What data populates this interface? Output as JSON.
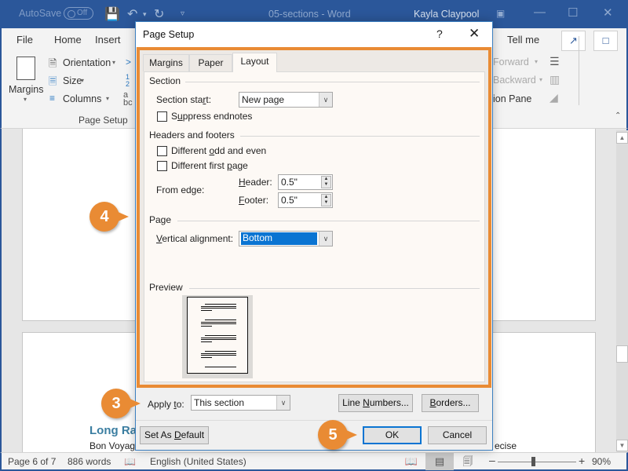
{
  "titlebar": {
    "autosave_label": "AutoSave",
    "autosave_state": "Off",
    "document_title": "05-sections - Word",
    "user_name": "Kayla Claypool"
  },
  "ribbon": {
    "tabs": [
      "File",
      "Home",
      "Insert"
    ],
    "tell_me": "Tell me",
    "page_setup": {
      "margins_label": "Margins",
      "orientation_label": "Orientation",
      "size_label": "Size",
      "columns_label": "Columns",
      "group_label": "Page Setup"
    },
    "arrange": {
      "bring_forward": "Forward",
      "send_backward": "Backward",
      "selection_pane": "ion Pane"
    }
  },
  "document": {
    "heading_partial": "Long Ran",
    "text_partial": "Bon Voyage",
    "text_right_partial": "ecise"
  },
  "dialog": {
    "title": "Page Setup",
    "help": "?",
    "tabs": [
      {
        "label": "Margins",
        "active": false
      },
      {
        "label": "Paper",
        "active": false
      },
      {
        "label": "Layout",
        "active": true
      }
    ],
    "section": {
      "heading": "Section",
      "section_start_label": "Section sta",
      "section_start_u": "r",
      "section_start_rest": "t:",
      "section_start_value": "New page",
      "suppress_endnotes_pre": "S",
      "suppress_endnotes_u": "u",
      "suppress_endnotes_rest": "ppress endnotes",
      "suppress_endnotes_checked": false
    },
    "headers_footers": {
      "heading": "Headers and footers",
      "odd_even_pre": "Different ",
      "odd_even_u": "o",
      "odd_even_rest": "dd and even",
      "odd_even_checked": false,
      "first_page_pre": "Different first ",
      "first_page_u": "p",
      "first_page_rest": "age",
      "first_page_checked": false,
      "from_edge_label": "From edge:",
      "header_u": "H",
      "header_rest": "eader:",
      "header_value": "0.5\"",
      "footer_u": "F",
      "footer_rest": "ooter:",
      "footer_value": "0.5\""
    },
    "page": {
      "heading": "Page",
      "vertical_alignment_u": "V",
      "vertical_alignment_rest": "ertical alignment:",
      "vertical_alignment_value": "Bottom"
    },
    "preview": {
      "heading": "Preview"
    },
    "apply_to_pre": "Apply ",
    "apply_to_u": "t",
    "apply_to_rest": "o:",
    "apply_to_value": "This section",
    "line_numbers_pre": "Line ",
    "line_numbers_u": "N",
    "line_numbers_rest": "umbers...",
    "borders_u": "B",
    "borders_rest": "orders...",
    "set_default_pre": "Set As ",
    "set_default_u": "D",
    "set_default_rest": "efault",
    "ok_label": "OK",
    "cancel_label": "Cancel"
  },
  "callouts": {
    "step_3": "3",
    "step_4": "4",
    "step_5": "5",
    "color": "#e98b34"
  },
  "statusbar": {
    "page": "Page 6 of 7",
    "words": "886 words",
    "language": "English (United States)",
    "zoom": "90%",
    "zoom_value_percent": 90
  },
  "colors": {
    "word_blue": "#2b579a",
    "highlight_orange": "#e98b34",
    "selection_blue": "#0a74d2",
    "heading_teal": "#3b7ea1"
  }
}
